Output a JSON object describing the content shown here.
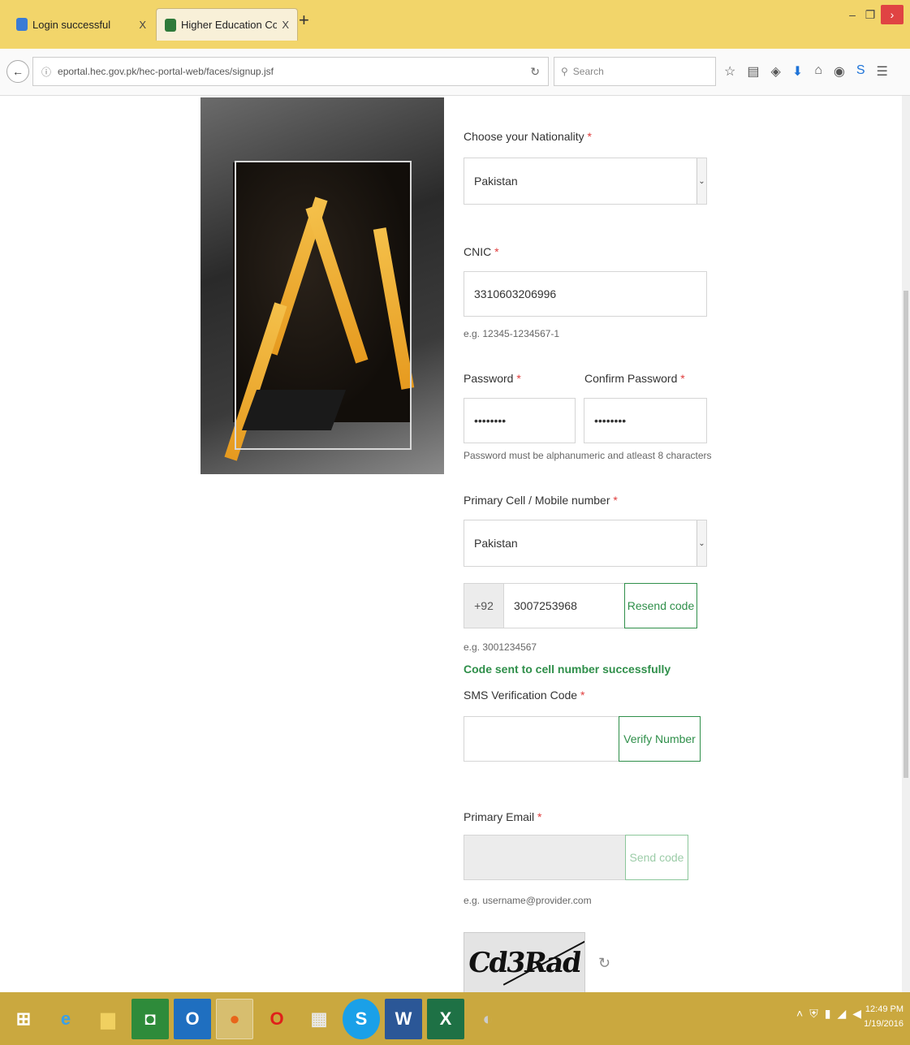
{
  "browser": {
    "tabs": [
      {
        "title": "Login successful",
        "favicon_color": "#3a7bd5"
      },
      {
        "title": "Higher Education Commi...",
        "favicon_color": "#2f7a3a"
      }
    ],
    "tab_close": "X",
    "new_tab": "+",
    "url": "eportal.hec.gov.pk/hec-portal-web/faces/signup.jsf",
    "search_placeholder": "Search"
  },
  "form": {
    "nationality_label": "Choose your Nationality",
    "nationality_value": "Pakistan",
    "cnic_label": "CNIC",
    "cnic_value": "3310603206996",
    "cnic_hint": "e.g. 12345-1234567-1",
    "password_label": "Password",
    "password_value": "••••••••",
    "confirm_label": "Confirm Password",
    "confirm_value": "••••••••",
    "password_hint": "Password must be alphanumeric and atleast 8 characters",
    "mobile_label": "Primary Cell / Mobile number",
    "mobile_country": "Pakistan",
    "mobile_prefix": "+92",
    "mobile_value": "3007253968",
    "resend_label": "Resend code",
    "mobile_hint": "e.g. 3001234567",
    "success_msg": "Code sent to cell number successfully",
    "sms_label": "SMS Verification Code",
    "verify_label": "Verify Number",
    "email_label": "Primary Email",
    "send_code_label": "Send code",
    "email_hint": "e.g. username@provider.com",
    "captcha_text": "Cd3Rad",
    "required_mark": "*"
  },
  "taskbar": {
    "time": "12:49 PM",
    "date": "1/19/2016"
  }
}
